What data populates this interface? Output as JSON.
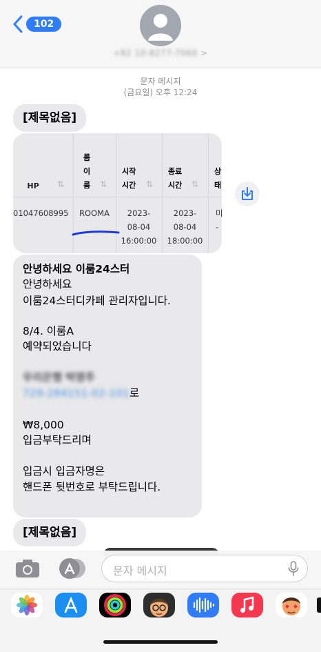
{
  "header": {
    "back_count": "102",
    "contact_number": "+82 10-8277-7060",
    "chevron": ">"
  },
  "timestamp": {
    "line1": "문자 메시지",
    "line2": "(금요일) 오후 12:24"
  },
  "messages": {
    "subject1": "[제목없음]",
    "subject2": "[제목없음]",
    "table": {
      "headers": [
        "HP",
        "룸\n이\n름",
        "시작\n시간",
        "종료\n시간",
        "상\n태"
      ],
      "row": {
        "hp": "01047608995",
        "room": "ROOMA",
        "start": [
          "2023-",
          "08-04",
          "16:00:00"
        ],
        "end": [
          "2023-",
          "08-04",
          "18:00:00"
        ],
        "status": [
          "미",
          "-"
        ]
      }
    },
    "body": {
      "title": "안녕하세요  이룸24스터",
      "line1": "안녕하세요",
      "line2": "이룸24스터디카페 관리자입니다.",
      "line3": "8/4. 이룸A",
      "line4": "예약되었습니다",
      "bank": "우리은행 박영주",
      "account": "729-284151-02-101",
      "account_suffix": "로",
      "amount": "₩8,000",
      "line5": "입금부탁드리며",
      "line6": "입금시 입금자명은",
      "line7": "핸드폰 뒷번호로 부탁드립니다."
    }
  },
  "input": {
    "placeholder": "문자 메시지"
  },
  "apps": [
    "photos-icon",
    "app-store-icon",
    "fitness-icon",
    "memoji-icon",
    "audio-icon",
    "music-icon",
    "memoji-2-icon"
  ],
  "colors": {
    "accent": "#2f7cf6",
    "bubble": "#e9e9eb",
    "link": "#4a90e2"
  }
}
